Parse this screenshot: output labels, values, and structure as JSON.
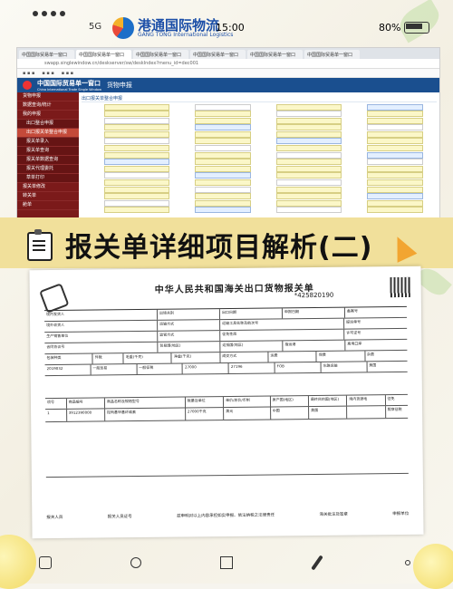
{
  "status_bar": {
    "signal": "5G",
    "time": "15:00",
    "battery": "80%"
  },
  "watermark": {
    "brand_cn": "港通国际物流",
    "brand_en": "GANG TONG International Logistics"
  },
  "browser": {
    "tabs": [
      "中国国际贸易单一窗口",
      "中国国际贸易单一窗口",
      "中国国际贸易单一窗口",
      "中国国际贸易单一窗口",
      "中国国际贸易单一窗口",
      "中国国际贸易单一窗口"
    ],
    "address": "swapp.singlewindow.cn/deskserver/sw/deskIndex?menu_id=dec001",
    "header": {
      "title": "中国国际贸易单一窗口",
      "subtitle": "China International Trade Single Window",
      "module": "货物申报"
    },
    "sidebar_items": [
      "货物申报",
      "数据查询/统计",
      "我的申报",
      "出口整合申报",
      "出口报关单整合申报",
      "报关单录入",
      "报关单查询",
      "报关单数据查询",
      "报关代理委托",
      "草单打印",
      "报关单修改",
      "转关单",
      "舱单"
    ],
    "form_label": "出口报关单整合申报"
  },
  "banner": {
    "title": "报关单详细项目解析(二)"
  },
  "document": {
    "title": "中华人民共和国海关出口货物报关单",
    "number": "*425820190",
    "fields_row1": [
      "境内发货人",
      "出境关别",
      "出口日期",
      "申报日期",
      "备案号"
    ],
    "fields_row2": [
      "境外收货人",
      "运输方式",
      "运输工具名称及航次号",
      "提运单号"
    ],
    "fields_row3": [
      "生产销售单位",
      "监管方式",
      "征免性质",
      "许可证号"
    ],
    "fields_row4": [
      "合同协议号",
      "贸易国(地区)",
      "运抵国(地区)",
      "指运港",
      "离境口岸"
    ],
    "fields_row5": [
      "包装种类",
      "件数",
      "毛重(千克)",
      "净重(千克)",
      "成交方式",
      "运费",
      "保费",
      "杂费"
    ],
    "doc_values": [
      "2019032",
      "一般贸易",
      "一般征税",
      "27000",
      "27196",
      "FOB",
      "水路运输",
      "美国"
    ],
    "goods_header": [
      "项号",
      "商品编号",
      "商品名称及规格型号",
      "数量及单位",
      "单价/总价/币制",
      "原产国(地区)",
      "最终目的国(地区)",
      "境内货源地",
      "征免"
    ],
    "goods_row": [
      "1",
      "3912390000",
      "羟丙基甲基纤维素",
      "27000千克",
      "美元",
      "中国",
      "美国",
      "照章征税"
    ],
    "declaration": [
      "报关人员",
      "报关人员证号",
      "兹申明对以上内容承担如实申报、依法纳税之法律责任",
      "海关批注及签章",
      "申报单位"
    ]
  },
  "toolbar": [
    "delete-icon",
    "share-icon",
    "crop-icon",
    "edit-icon",
    "more-icon"
  ]
}
